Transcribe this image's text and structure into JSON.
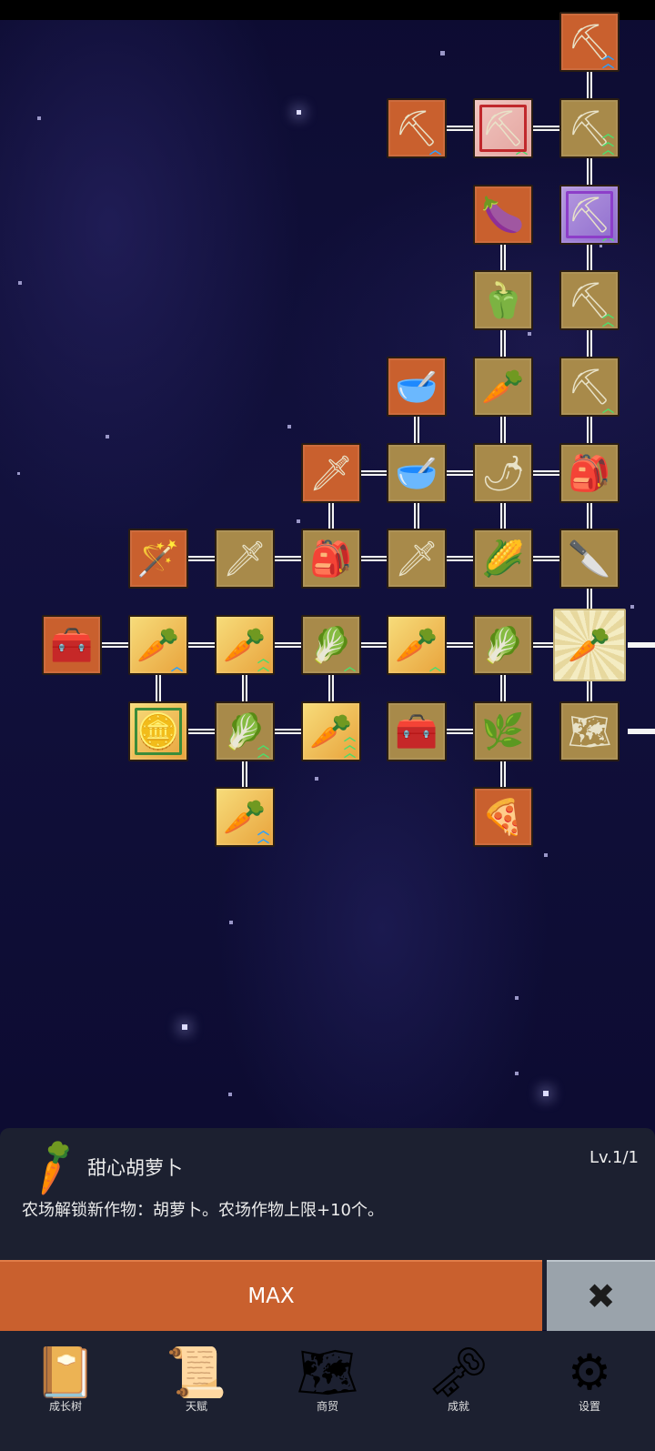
{
  "info_panel": {
    "title": "甜心胡萝卜",
    "level": "Lv.1/1",
    "description": "农场解锁新作物：胡萝卜。农场作物上限+10个。",
    "icon": "carrot-icon"
  },
  "actions": {
    "max_label": "MAX",
    "close_icon": "close-icon"
  },
  "tabs": [
    {
      "label": "成长树",
      "icon": "book-icon"
    },
    {
      "label": "天赋",
      "icon": "scroll-icon"
    },
    {
      "label": "商贸",
      "icon": "map-icon"
    },
    {
      "label": "成就",
      "icon": "key-icon"
    },
    {
      "label": "设置",
      "icon": "gear-icon"
    }
  ],
  "colors": {
    "node_unlocked": "#c9602e",
    "node_owned": "#a88a4a",
    "panel_bg": "#1c2030",
    "max_button": "#c9602e",
    "close_button": "#9aa3ab",
    "upgrade_blue": "#2aa0ff",
    "upgrade_green": "#4fdc6a"
  },
  "skill_nodes": [
    {
      "id": "n1",
      "icon": "shovel-icon",
      "state": "unlocked",
      "upgrade": "blue-2"
    },
    {
      "id": "n2",
      "icon": "shovel-icon",
      "state": "unlocked",
      "upgrade": "blue-1"
    },
    {
      "id": "n3",
      "icon": "shovel-icon",
      "state": "rare-red",
      "upgrade": "green-1"
    },
    {
      "id": "n4",
      "icon": "shovel-icon",
      "state": "owned",
      "upgrade": "green-3"
    },
    {
      "id": "n5",
      "icon": "eggplant-icon",
      "state": "unlocked"
    },
    {
      "id": "n6",
      "icon": "shovel-icon",
      "state": "rare-purple",
      "upgrade": "green-1"
    },
    {
      "id": "n7",
      "icon": "pepper-icon",
      "state": "owned"
    },
    {
      "id": "n8",
      "icon": "shovel-icon",
      "state": "owned",
      "upgrade": "green-2"
    },
    {
      "id": "n9",
      "icon": "bowl-icon",
      "state": "unlocked"
    },
    {
      "id": "n10",
      "icon": "radish-icon",
      "state": "owned"
    },
    {
      "id": "n11",
      "icon": "shovel-icon",
      "state": "owned",
      "upgrade": "green-1"
    },
    {
      "id": "n12",
      "icon": "sword-icon",
      "state": "unlocked"
    },
    {
      "id": "n13",
      "icon": "bowl-icon",
      "state": "owned"
    },
    {
      "id": "n14",
      "icon": "chili-icon",
      "state": "owned"
    },
    {
      "id": "n15",
      "icon": "backpack-icon",
      "state": "owned"
    },
    {
      "id": "n16",
      "icon": "wand-icon",
      "state": "unlocked"
    },
    {
      "id": "n17",
      "icon": "sword-icon",
      "state": "owned"
    },
    {
      "id": "n18",
      "icon": "backpack-icon",
      "state": "owned"
    },
    {
      "id": "n19",
      "icon": "sword-icon",
      "state": "owned"
    },
    {
      "id": "n20",
      "icon": "corn-icon",
      "state": "owned"
    },
    {
      "id": "n21",
      "icon": "dagger-icon",
      "state": "owned"
    },
    {
      "id": "n22",
      "icon": "chest-icon",
      "state": "unlocked"
    },
    {
      "id": "n23",
      "icon": "carrot-icon",
      "state": "gold",
      "upgrade": "blue-1"
    },
    {
      "id": "n24",
      "icon": "carrot-icon",
      "state": "gold",
      "upgrade": "green-2"
    },
    {
      "id": "n25",
      "icon": "cabbage-icon",
      "state": "owned",
      "upgrade": "green-1"
    },
    {
      "id": "n26",
      "icon": "carrot-icon",
      "state": "gold",
      "upgrade": "green-1"
    },
    {
      "id": "n27",
      "icon": "cabbage-icon",
      "state": "owned"
    },
    {
      "id": "n28",
      "icon": "carrot-icon",
      "state": "selected"
    },
    {
      "id": "n29",
      "icon": "coin-icon",
      "state": "rare-green"
    },
    {
      "id": "n30",
      "icon": "cabbage-icon",
      "state": "owned",
      "upgrade": "green-2"
    },
    {
      "id": "n31",
      "icon": "carrot-icon",
      "state": "gold",
      "upgrade": "green-3"
    },
    {
      "id": "n32",
      "icon": "chest-icon",
      "state": "owned"
    },
    {
      "id": "n33",
      "icon": "leek-icon",
      "state": "owned"
    },
    {
      "id": "n34",
      "icon": "map-icon",
      "state": "owned"
    },
    {
      "id": "n35",
      "icon": "carrot-icon",
      "state": "gold",
      "upgrade": "blue-2"
    },
    {
      "id": "n36",
      "icon": "pizza-icon",
      "state": "unlocked"
    }
  ]
}
